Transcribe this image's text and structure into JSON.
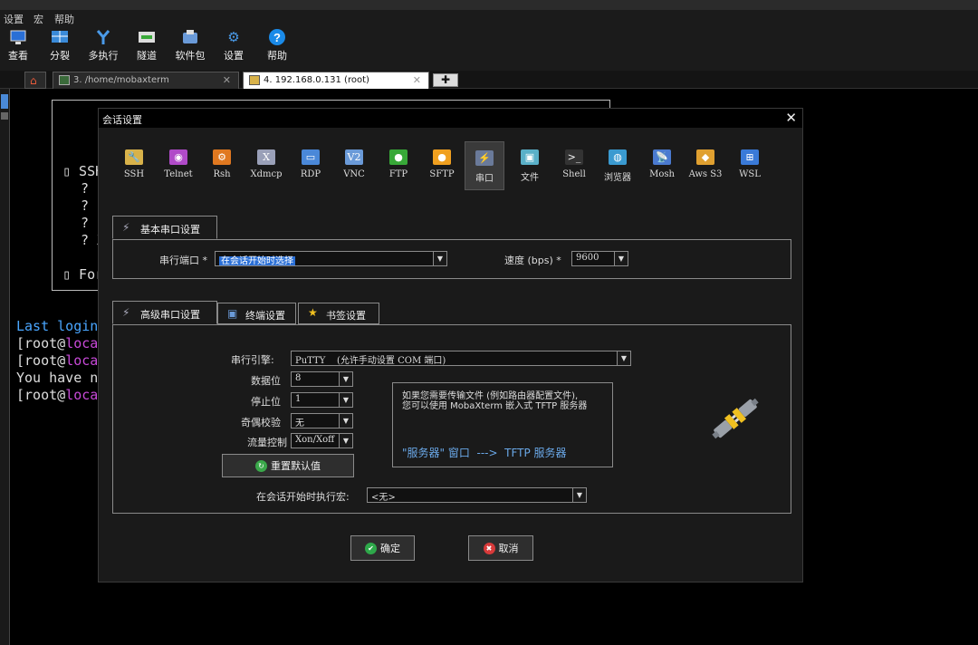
{
  "menu": [
    "设置",
    "宏",
    "帮助"
  ],
  "toolbar": [
    {
      "label": "查看",
      "icon": "monitor-icon"
    },
    {
      "label": "分裂",
      "icon": "split-icon"
    },
    {
      "label": "多执行",
      "icon": "fork-icon"
    },
    {
      "label": "隧道",
      "icon": "tunnel-icon"
    },
    {
      "label": "软件包",
      "icon": "package-icon"
    },
    {
      "label": "设置",
      "icon": "gears-icon"
    },
    {
      "label": "帮助",
      "icon": "help-icon"
    }
  ],
  "tabs": [
    {
      "label": "3. /home/mobaxterm",
      "close": "✕"
    },
    {
      "label": "4. 192.168.0.131 (root)",
      "close": "✕"
    }
  ],
  "terminal": {
    "box_lines": [
      "▯ SSH",
      "? [",
      "? S",
      "? S",
      "? X",
      "▯ For"
    ],
    "lines": [
      {
        "pre": "Last login",
        "post": "",
        "color": "#4aa6ff"
      },
      {
        "pre": "[root@",
        "post": "local",
        "color": "#ddd"
      },
      {
        "pre": "[root@",
        "post": "local",
        "color": "#ddd"
      },
      {
        "pre": "You have no",
        "post": "",
        "color": "#ddd"
      },
      {
        "pre": "[root@",
        "post": "local",
        "color": "#ddd"
      }
    ]
  },
  "dialog": {
    "title": "会话设置",
    "close": "✕",
    "session_types": [
      {
        "label": "SSH",
        "icon": "ssh-icon",
        "color": "#d8b24a",
        "glyph": "🔧"
      },
      {
        "label": "Telnet",
        "icon": "telnet-icon",
        "color": "#b04ac8",
        "glyph": "◉"
      },
      {
        "label": "Rsh",
        "icon": "rsh-icon",
        "color": "#e07820",
        "glyph": "⚙"
      },
      {
        "label": "Xdmcp",
        "icon": "xdmcp-icon",
        "color": "#9aa0b8",
        "glyph": "X"
      },
      {
        "label": "RDP",
        "icon": "rdp-icon",
        "color": "#4a88d8",
        "glyph": "▭"
      },
      {
        "label": "VNC",
        "icon": "vnc-icon",
        "color": "#6a9ad8",
        "glyph": "V2"
      },
      {
        "label": "FTP",
        "icon": "ftp-icon",
        "color": "#38a838",
        "glyph": "●"
      },
      {
        "label": "SFTP",
        "icon": "sftp-icon",
        "color": "#f0a020",
        "glyph": "●"
      },
      {
        "label": "串口",
        "icon": "serial-icon",
        "color": "#6a7a9a",
        "glyph": "⚡"
      },
      {
        "label": "文件",
        "icon": "file-icon",
        "color": "#5ab0c8",
        "glyph": "▣"
      },
      {
        "label": "Shell",
        "icon": "shell-icon",
        "color": "#333333",
        "glyph": ">_"
      },
      {
        "label": "浏览器",
        "icon": "browser-icon",
        "color": "#3a9ad0",
        "glyph": "◍"
      },
      {
        "label": "Mosh",
        "icon": "mosh-icon",
        "color": "#4a7ad0",
        "glyph": "📡"
      },
      {
        "label": "Aws S3",
        "icon": "aws-s3-icon",
        "color": "#e0a030",
        "glyph": "◆"
      },
      {
        "label": "WSL",
        "icon": "wsl-icon",
        "color": "#3a7ad8",
        "glyph": "⊞"
      }
    ],
    "basic": {
      "tab": "基本串口设置",
      "port_label": "串行端口 *",
      "port_value": "在会话开始时选择",
      "speed_label": "速度 (bps) *",
      "speed_value": "9600"
    },
    "adv_tabs": [
      "高级串口设置",
      "终端设置",
      "书签设置"
    ],
    "advanced": {
      "engine_label": "串行引擎:",
      "engine_value": "PuTTY    (允许手动设置 COM 端口)",
      "databits_label": "数据位",
      "databits_value": "8",
      "stopbits_label": "停止位",
      "stopbits_value": "1",
      "parity_label": "奇偶校验",
      "parity_value": "无",
      "flow_label": "流量控制",
      "flow_value": "Xon/Xoff",
      "reset_button": "重置默认值",
      "info_line1": "如果您需要传输文件 (例如路由器配置文件),",
      "info_line2": "您可以使用 MobaXterm 嵌入式 TFTP 服务器",
      "info_link": "\"服务器\" 窗口  --->  TFTP 服务器",
      "macro_label": "在会话开始时执行宏:",
      "macro_value": "<无>"
    },
    "ok_button": "确定",
    "cancel_button": "取消"
  },
  "colors": {
    "selection": "#2a6fd6",
    "link": "#6aa8e8",
    "ok": "#2ea84a",
    "cancel": "#d83a3a",
    "reset": "#3aa84a"
  }
}
